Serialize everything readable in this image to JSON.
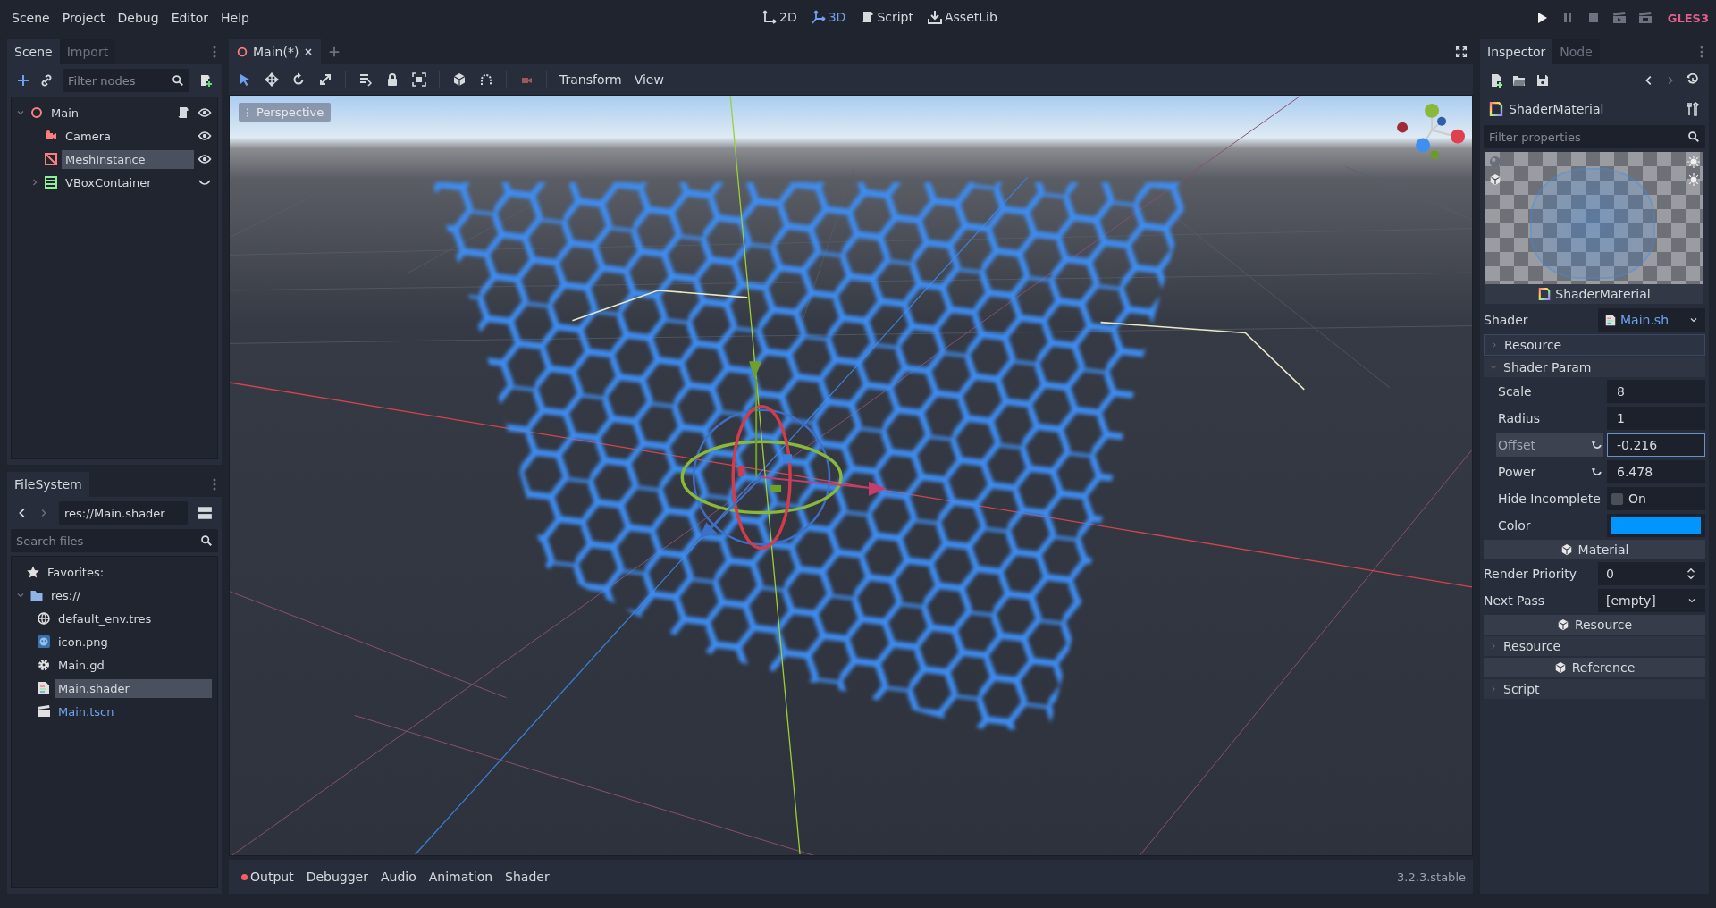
{
  "menu": [
    {
      "label": "Scene"
    },
    {
      "label": "Project"
    },
    {
      "label": "Debug"
    },
    {
      "label": "Editor"
    },
    {
      "label": "Help"
    }
  ],
  "workspaces": [
    {
      "label": "2D",
      "kind": "twod",
      "selected": false
    },
    {
      "label": "3D",
      "kind": "threed",
      "selected": true
    },
    {
      "label": "Script",
      "kind": "script",
      "selected": false
    },
    {
      "label": "AssetLib",
      "kind": "assetlib",
      "selected": false
    }
  ],
  "run_buttons": [
    {
      "kind": "play"
    },
    {
      "kind": "pause"
    },
    {
      "kind": "stop"
    },
    {
      "kind": "play-scene"
    },
    {
      "kind": "play-custom"
    }
  ],
  "renderer": "GLES3",
  "scene_dock": {
    "tabs": [
      {
        "label": "Scene",
        "selected": true
      },
      {
        "label": "Import",
        "selected": false
      }
    ],
    "filter_placeholder": "Filter nodes",
    "tree": [
      {
        "label": "Main",
        "kind": "spatial",
        "selected": false,
        "expanded": true,
        "has_script": true,
        "children": [
          {
            "label": "Camera",
            "kind": "camera",
            "selected": false,
            "has_script": false
          },
          {
            "label": "MeshInstance",
            "kind": "mesh",
            "selected": true,
            "has_script": false
          },
          {
            "label": "VBoxContainer",
            "kind": "vbox",
            "selected": false,
            "expanded": false,
            "has_script": false
          }
        ]
      }
    ]
  },
  "filesystem": {
    "tabs": [
      {
        "label": "FileSystem",
        "selected": true
      }
    ],
    "path": "res://Main.shader",
    "search_placeholder": "Search files",
    "favorites": "Favorites:",
    "tree": [
      {
        "label": "res://",
        "kind": "folder",
        "expanded": true,
        "selected": false,
        "current": false,
        "children": [
          {
            "label": "default_env.tres",
            "kind": "environment",
            "selected": false,
            "current": false
          },
          {
            "label": "icon.png",
            "kind": "image",
            "selected": false,
            "current": false
          },
          {
            "label": "Main.gd",
            "kind": "script",
            "selected": false,
            "current": false
          },
          {
            "label": "Main.shader",
            "kind": "shader",
            "selected": true,
            "current": false
          },
          {
            "label": "Main.tscn",
            "kind": "scene",
            "selected": false,
            "current": true
          }
        ]
      }
    ]
  },
  "editor_tabs": [
    {
      "label": "Main(*)",
      "selected": true
    }
  ],
  "viewport": {
    "tools": [
      {
        "kind": "select",
        "selected": true
      },
      {
        "kind": "move",
        "selected": false
      },
      {
        "kind": "rotate",
        "selected": false
      },
      {
        "kind": "scale",
        "selected": false
      },
      {
        "kind": "list",
        "selected": false
      },
      {
        "kind": "lock",
        "selected": false
      },
      {
        "kind": "group",
        "selected": false
      },
      {
        "kind": "local",
        "selected": false
      },
      {
        "kind": "snap",
        "selected": false
      },
      {
        "kind": "camera",
        "selected": false
      }
    ],
    "menus": [
      {
        "label": "Transform"
      },
      {
        "label": "View"
      }
    ],
    "view_label": "Perspective"
  },
  "bottom_tabs": [
    {
      "label": "Output",
      "alert": true
    },
    {
      "label": "Debugger",
      "alert": false
    },
    {
      "label": "Audio",
      "alert": false
    },
    {
      "label": "Animation",
      "alert": false
    },
    {
      "label": "Shader",
      "alert": false
    }
  ],
  "version": "3.2.3.stable",
  "inspector": {
    "tabs": [
      {
        "label": "Inspector",
        "selected": true
      },
      {
        "label": "Node",
        "selected": false
      }
    ],
    "resource_title": "ShaderMaterial",
    "filter_placeholder": "Filter properties",
    "preview_caption": "ShaderMaterial",
    "properties": [
      {
        "kind": "resource",
        "label": "Shader",
        "value": "Main.sh"
      },
      {
        "kind": "subresource",
        "label": "Resource",
        "expanded": false
      },
      {
        "kind": "section",
        "label": "Shader Param",
        "expanded": true,
        "children": [
          {
            "kind": "number",
            "label": "Scale",
            "value": "8",
            "revertable": false,
            "focused": false
          },
          {
            "kind": "number",
            "label": "Radius",
            "value": "1",
            "revertable": false,
            "focused": false
          },
          {
            "kind": "number",
            "label": "Offset",
            "value": "-0.216",
            "revertable": true,
            "focused": true
          },
          {
            "kind": "number",
            "label": "Power",
            "value": "6.478",
            "revertable": true,
            "focused": false
          },
          {
            "kind": "checkbox",
            "label": "Hide Incomplete",
            "value": "On",
            "checked": false
          },
          {
            "kind": "color",
            "label": "Color",
            "color": "#0095ff"
          }
        ]
      },
      {
        "kind": "category",
        "label": "Material"
      },
      {
        "kind": "spin",
        "label": "Render Priority",
        "value": "0"
      },
      {
        "kind": "dropdown",
        "label": "Next Pass",
        "value": "[empty]"
      },
      {
        "kind": "category",
        "label": "Resource"
      },
      {
        "kind": "section",
        "label": "Resource",
        "expanded": false
      },
      {
        "kind": "category",
        "label": "Reference"
      },
      {
        "kind": "section",
        "label": "Script",
        "expanded": false
      }
    ]
  }
}
